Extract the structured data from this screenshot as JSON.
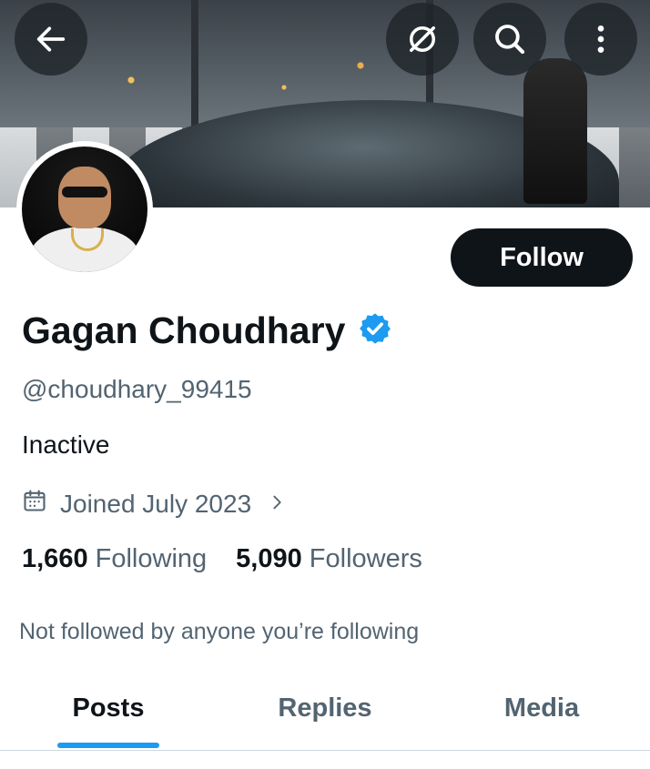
{
  "profile": {
    "name": "Gagan Choudhary",
    "handle": "@choudhary_99415",
    "bio": "Inactive",
    "joined": "Joined July 2023",
    "following_count": "1,660",
    "following_label": "Following",
    "followers_count": "5,090",
    "followers_label": "Followers",
    "not_followed_text": "Not followed by anyone you’re following",
    "verified": true
  },
  "header": {
    "back_icon": "arrow-left-icon",
    "grok_icon": "slashed-circle-icon",
    "search_icon": "search-icon",
    "more_icon": "more-vertical-icon"
  },
  "actions": {
    "follow_label": "Follow"
  },
  "tabs": [
    {
      "label": "Posts",
      "active": true
    },
    {
      "label": "Replies",
      "active": false
    },
    {
      "label": "Media",
      "active": false
    }
  ],
  "colors": {
    "accent": "#1d9bf0",
    "text_primary": "#0f1419",
    "text_secondary": "#536471",
    "button_dark": "#0f1419"
  }
}
